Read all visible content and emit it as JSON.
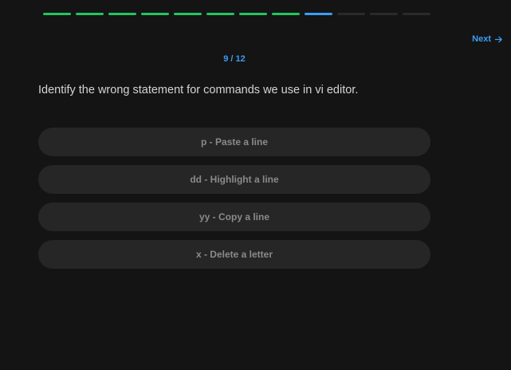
{
  "progress": {
    "total": 12,
    "current": 9,
    "colors": {
      "done": "#22c55e",
      "current": "#3b9cf5",
      "pending": "#2a2a2a"
    }
  },
  "nav": {
    "next_label": "Next",
    "next_icon": "arrow-right-icon"
  },
  "counter": "9 / 12",
  "question": "Identify the wrong statement for commands we use in vi editor.",
  "options": [
    {
      "label": "p - Paste a line"
    },
    {
      "label": "dd - Highlight a line"
    },
    {
      "label": "yy - Copy a line"
    },
    {
      "label": "x - Delete a letter"
    }
  ],
  "colors": {
    "accent": "#3b9cf5",
    "background": "#141414",
    "option_bg": "#262626"
  }
}
